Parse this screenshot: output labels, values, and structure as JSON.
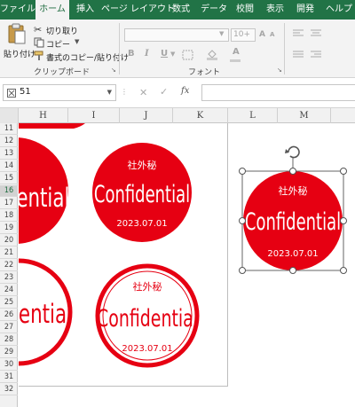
{
  "ribbon_tabs": [
    "ファイル",
    "ホーム",
    "挿入",
    "ページ レイアウト",
    "数式",
    "データ",
    "校閲",
    "表示",
    "開発",
    "ヘルプ"
  ],
  "clipboard": {
    "paste_label": "貼り付け",
    "cut_label": "切り取り",
    "copy_label": "コピー",
    "format_painter_label": "書式のコピー/貼り付け",
    "group_label": "クリップボード"
  },
  "font_group": {
    "group_label": "フォント",
    "size_value": "10+",
    "bold": "B",
    "italic": "I",
    "underline": "U",
    "color_glyph": "A"
  },
  "formula_bar": {
    "name_box": "51",
    "formula": ""
  },
  "columns": [
    "H",
    "I",
    "J",
    "K",
    "L",
    "M"
  ],
  "rows": [
    "11",
    "12",
    "13",
    "14",
    "15",
    "16",
    "17",
    "18",
    "19",
    "20",
    "21",
    "22",
    "23",
    "24",
    "25",
    "26",
    "27",
    "28",
    "29",
    "30",
    "31",
    "32"
  ],
  "selected_row": "16",
  "stamp": {
    "top_text": "社外秘",
    "main_text": "Confidential",
    "date_text": "2023.07.01",
    "partial_main_text": "fidential",
    "partial_main_text_2": "dential",
    "color": "#e60012"
  }
}
